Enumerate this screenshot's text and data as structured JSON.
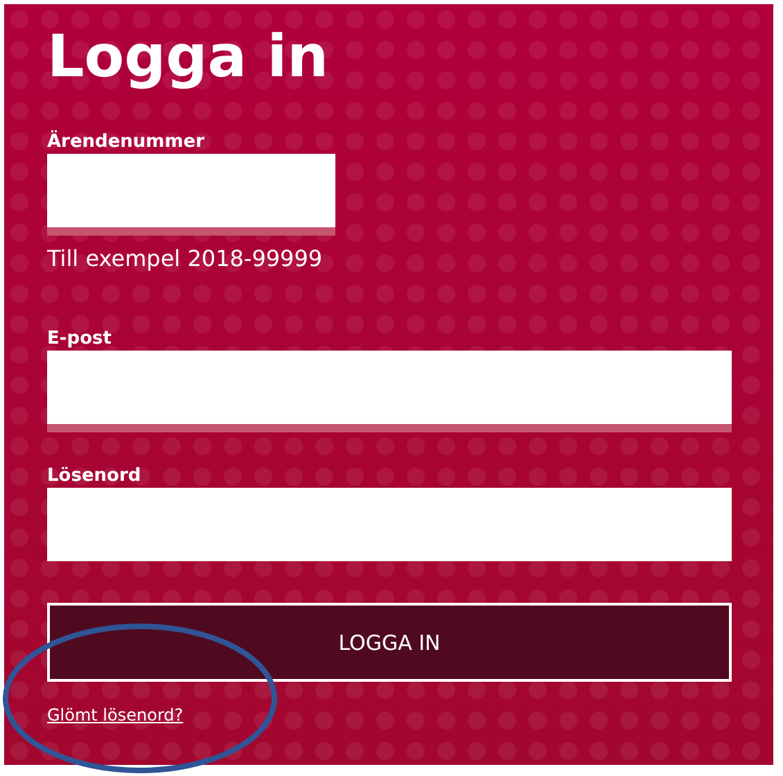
{
  "title": "Logga in",
  "fields": [
    {
      "label": "Ärendenummer",
      "kind": "short",
      "underlined": true,
      "hint": "Till exempel 2018-99999"
    },
    {
      "label": "E-post",
      "kind": "full",
      "underlined": true
    },
    {
      "label": "Lösenord",
      "kind": "full",
      "underlined": false
    }
  ],
  "submit_button": "LOGGA IN",
  "forgot_link": "Glömt lösenord?",
  "annotations": [
    {
      "kind": "ellipse",
      "color": "#2f5597"
    }
  ]
}
